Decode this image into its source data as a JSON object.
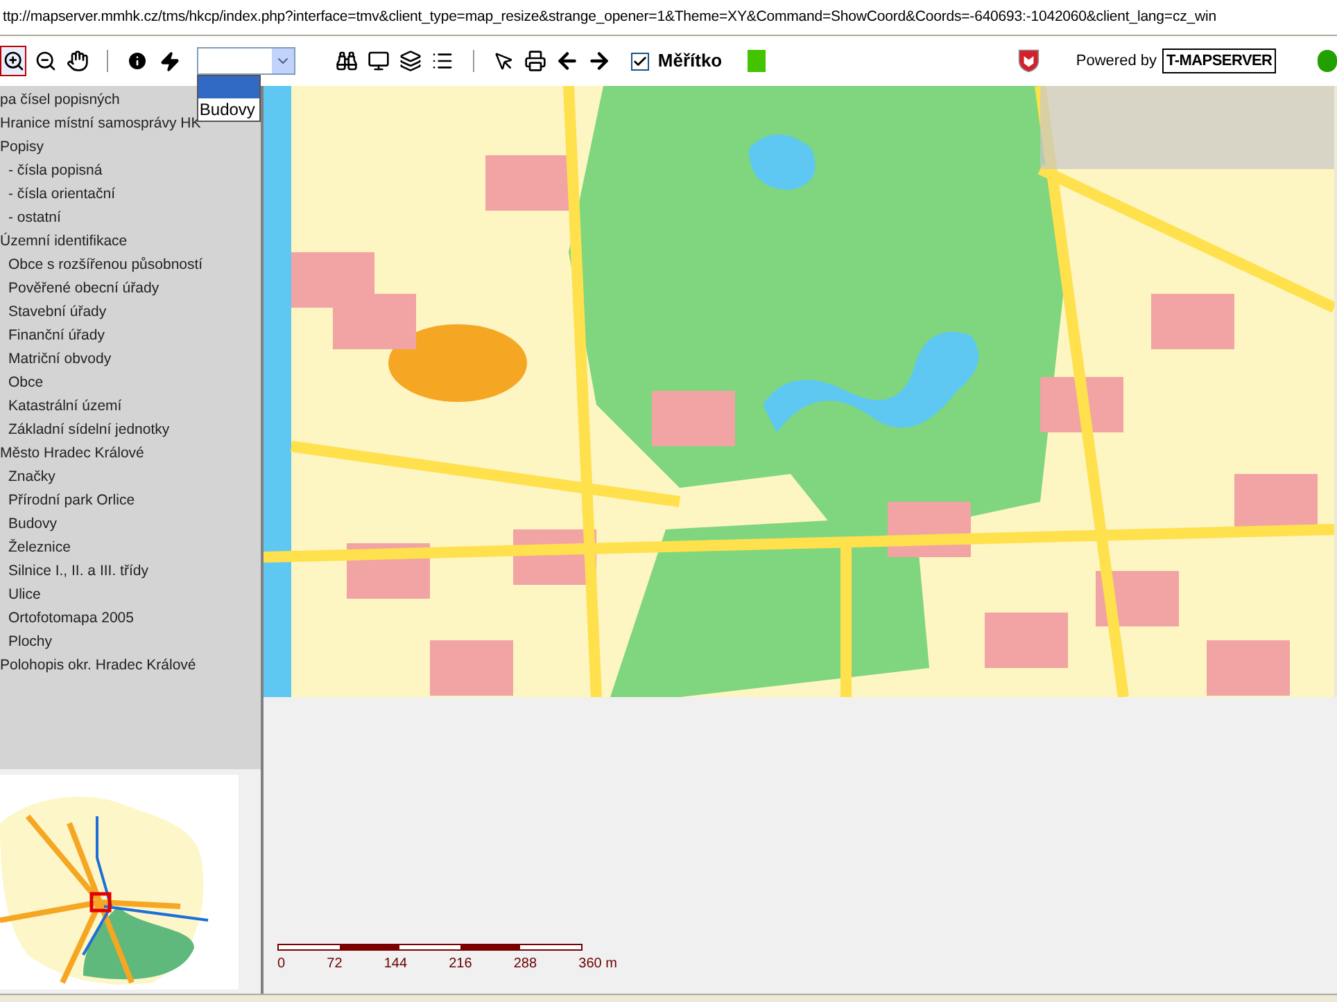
{
  "address_bar": {
    "url": "ttp://mapserver.mmhk.cz/tms/hkcp/index.php?interface=tmv&client_type=map_resize&strange_opener=1&Theme=XY&Command=ShowCoord&Coords=-640693:-1042060&client_lang=cz_win"
  },
  "toolbar": {
    "zoom_in_active": true,
    "dropdown": {
      "options": [
        {
          "selected": true
        },
        {
          "label": "Budovy",
          "selected": false
        }
      ]
    },
    "scale_checkbox": {
      "label": "Měřítko",
      "checked": true
    },
    "powered_by": "Powered by",
    "logo": "T-MAPSERVER"
  },
  "layers": [
    {
      "label": "pa čísel popisných"
    },
    {
      "label": "Hranice místní samosprávy HK"
    },
    {
      "label": "Popisy",
      "children": [
        {
          "label": "- čísla popisná"
        },
        {
          "label": "- čísla orientační"
        },
        {
          "label": "- ostatní"
        }
      ]
    },
    {
      "label": "Územní identifikace",
      "children": [
        {
          "label": "Obce s rozšířenou působností"
        },
        {
          "label": "Pověřené obecní úřady"
        },
        {
          "label": "Stavební úřady"
        },
        {
          "label": "Finanční úřady"
        },
        {
          "label": "Matriční obvody"
        },
        {
          "label": "Obce"
        },
        {
          "label": "Katastrální území"
        },
        {
          "label": "Základní sídelní jednotky"
        }
      ]
    },
    {
      "label": "Město Hradec Králové",
      "children": [
        {
          "label": "Značky"
        },
        {
          "label": "Přírodní park Orlice"
        },
        {
          "label": "Budovy"
        },
        {
          "label": "Železnice"
        },
        {
          "label": "Silnice I., II. a III. třídy"
        },
        {
          "label": "Ulice"
        },
        {
          "label": "Ortofotomapa 2005"
        },
        {
          "label": "Plochy"
        }
      ]
    },
    {
      "label": "Polohopis okr. Hradec Králové"
    }
  ],
  "scale_bar": {
    "labels": [
      "0",
      "72",
      "144",
      "216",
      "288",
      "360 m"
    ]
  }
}
